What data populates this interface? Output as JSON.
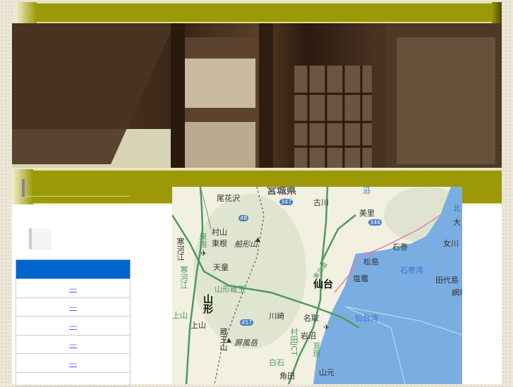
{
  "nav": {
    "links": [
      "—",
      "—",
      "—",
      "—",
      "—"
    ]
  },
  "map": {
    "labels": [
      "宮城県",
      "尾花沢",
      "村山",
      "東根",
      "東根",
      "寒河江",
      "天童",
      "船形山",
      "寒河江",
      "山形蔵王",
      "山形",
      "上山",
      "上山",
      "川崎",
      "蔵王山",
      "屏風岳",
      "名取",
      "岩沼",
      "村田JCT",
      "亘理",
      "白石",
      "角田",
      "古川",
      "美里",
      "石巻",
      "女川",
      "松島",
      "塩竈",
      "仙台",
      "石巻湾",
      "仙台湾",
      "田代島",
      "網地",
      "大",
      "北",
      "沿",
      "山元",
      "東北道",
      "347",
      "48",
      "457",
      "346"
    ]
  },
  "colors": {
    "olive": "#9b9908",
    "blue_header": "#0366cc",
    "sea": "#7aaee2"
  }
}
